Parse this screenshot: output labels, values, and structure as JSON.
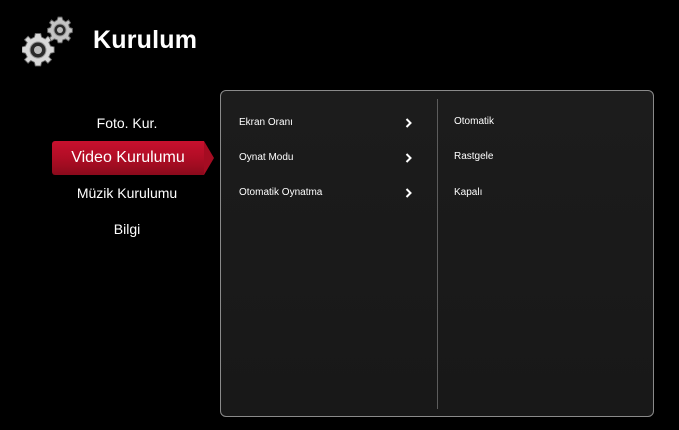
{
  "header": {
    "title": "Kurulum",
    "icon": "gear-icon"
  },
  "sidebar": {
    "items": [
      {
        "label": "Foto. Kur.",
        "selected": false
      },
      {
        "label": "Video Kurulumu",
        "selected": true
      },
      {
        "label": "Müzik Kurulumu",
        "selected": false
      },
      {
        "label": "Bilgi",
        "selected": false
      }
    ],
    "accent_color": "#c8102e"
  },
  "panel": {
    "options": [
      {
        "label": "Ekran Oranı",
        "icon": "chevron-right-icon"
      },
      {
        "label": "Oynat Modu",
        "icon": "chevron-right-icon"
      },
      {
        "label": "Otomatik Oynatma",
        "icon": "chevron-right-icon"
      }
    ],
    "values": [
      {
        "label": "Otomatik"
      },
      {
        "label": "Rastgele"
      },
      {
        "label": "Kapalı"
      }
    ]
  }
}
